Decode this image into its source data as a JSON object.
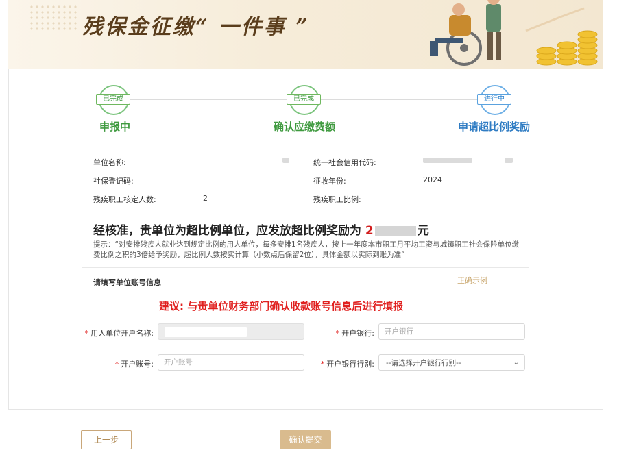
{
  "banner": {
    "title": "残保金征缴“ 一件事 ”"
  },
  "steps": [
    {
      "badge": "已完成",
      "label": "申报中",
      "state": "done"
    },
    {
      "badge": "已完成",
      "label": "确认应缴费额",
      "state": "done"
    },
    {
      "badge": "进行中",
      "label": "申请超比例奖励",
      "state": "active"
    }
  ],
  "info": {
    "unit_name_label": "单位名称:",
    "credit_code_label": "统一社会信用代码:",
    "social_reg_label": "社保登记码:",
    "year_label": "征收年份:",
    "year_value": "2024",
    "disabled_count_label": "残疾职工核定人数:",
    "disabled_count_value": "2",
    "disabled_ratio_label": "残疾职工比例:"
  },
  "headline": {
    "prefix": "经核准，贵单位为超比例单位，应发放超比例奖励为",
    "amount_visible": "2",
    "suffix": "元"
  },
  "tip": "提示：“对安排残疾人就业达到规定比例的用人单位，每多安排1名残疾人，按上一年度本市职工月平均工资与城镇职工社会保险单位缴费比例之积的3倍给予奖励，超比例人数按实计算（小数点后保留2位），具体金额以实际到账为准”",
  "account": {
    "section_title": "请填写单位账号信息",
    "example_link": "正确示例",
    "advice": "建议: 与贵单位财务部门确认收款账号信息后进行填报",
    "fields": {
      "holder_label": "用人单位开户名称:",
      "bank_label": "开户银行:",
      "bank_placeholder": "开户银行",
      "account_label": "开户账号:",
      "account_placeholder": "开户账号",
      "bank_type_label": "开户银行行别:",
      "bank_type_selected": "--请选择开户银行行别--"
    }
  },
  "buttons": {
    "prev": "上一步",
    "submit": "确认提交"
  },
  "colors": {
    "done": "#3f9a3f",
    "active": "#2f7cc3",
    "warning": "#e0201f",
    "accent": "#d9bb8e"
  }
}
